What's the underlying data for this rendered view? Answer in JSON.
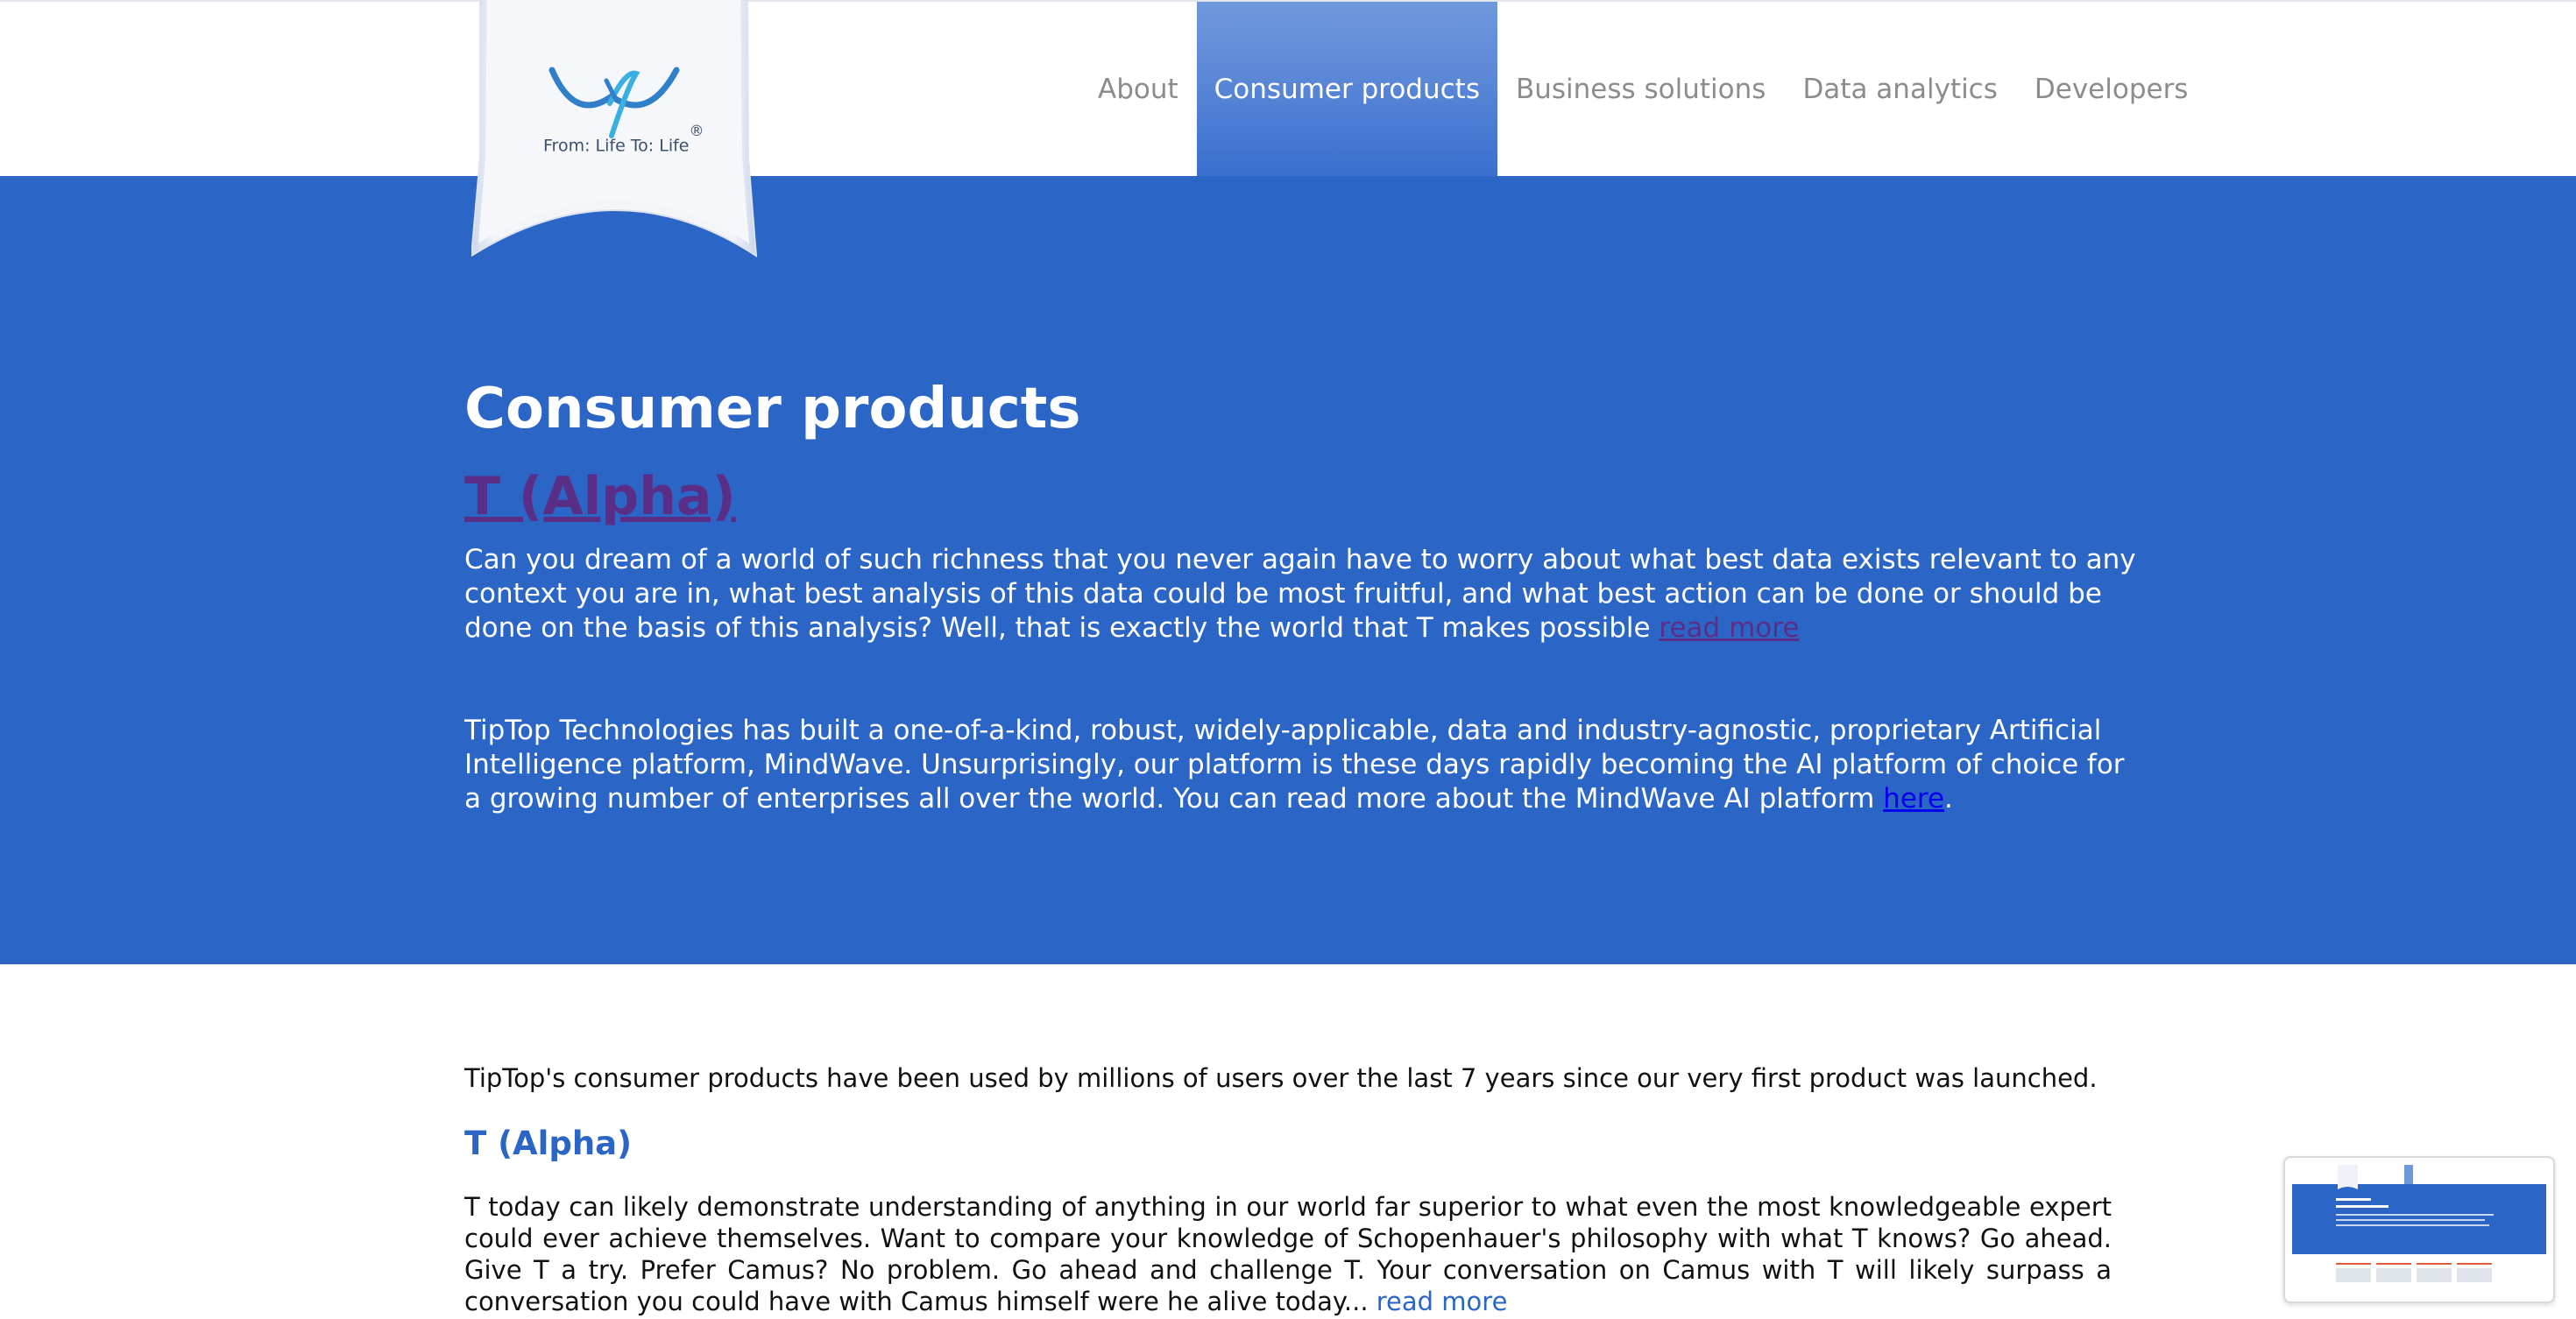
{
  "logo": {
    "tagline": "From: Life To: Life",
    "registered": "®",
    "icon": "tiptop-logo-icon"
  },
  "nav": {
    "items": [
      {
        "label": "About",
        "active": false
      },
      {
        "label": "Consumer products",
        "active": true
      },
      {
        "label": "Business solutions",
        "active": false
      },
      {
        "label": "Data analytics",
        "active": false
      },
      {
        "label": "Developers",
        "active": false
      }
    ]
  },
  "hero": {
    "title": "Consumer products",
    "subtitle": "T (Alpha)",
    "p1_text": "Can you dream of a world of such richness that you never again have to worry about what best data exists relevant to any context you are in, what best analysis of this data could be most fruitful, and what best action can be done or should be done on the basis of this analysis? Well, that is exactly the world that T makes possible ",
    "p1_link": "read more",
    "p2_text": "TipTop Technologies has built a one-of-a-kind, robust, widely-applicable, data and industry-agnostic, proprietary Artificial Intelligence platform, MindWave. Unsurprisingly, our platform is these days rapidly becoming the AI platform of choice for a growing number of enterprises all over the world. You can read more about the MindWave AI platform ",
    "p2_link": "here",
    "p2_end": "."
  },
  "content": {
    "intro": "TipTop's consumer products have been used by millions of users over the last 7 years since our very first product was launched.",
    "section_title": "T (Alpha)",
    "section_text": "T today can likely demonstrate understanding of anything in our world far superior to what even the most knowledgeable expert could ever achieve themselves. Want to compare your knowledge of Schopenhauer's philosophy with what T knows? Go ahead. Give T a try. Prefer Camus? No problem. Go ahead and challenge T. Your conversation on Camus with T will likely surpass a conversation you could have with Camus himself were he alive today... ",
    "section_link": "read more"
  },
  "colors": {
    "brand_blue": "#2b66c7",
    "visited_link": "#5a2d86",
    "link_blue": "#0000ee",
    "nav_gray": "#8c8c8c"
  }
}
